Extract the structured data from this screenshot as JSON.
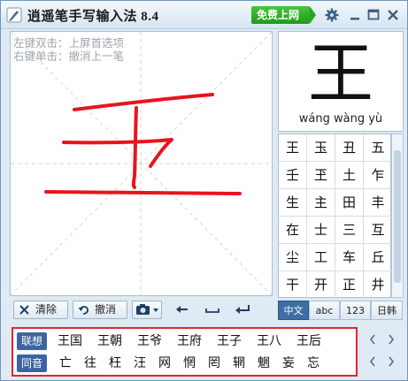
{
  "titlebar": {
    "title": "逍遥笔手写输入法 8.4",
    "free_button": "免费上网"
  },
  "canvas": {
    "hint_line1": "左键双击：上屏首选项",
    "hint_line2": "右键单击：撤消上一笔"
  },
  "toolbar": {
    "clear_label": "清除",
    "undo_label": "撤消"
  },
  "preview": {
    "char": "王",
    "pinyin": "wáng wàng yù"
  },
  "candidate_grid": [
    "王",
    "玉",
    "丑",
    "五",
    "壬",
    "玊",
    "土",
    "乍",
    "生",
    "主",
    "田",
    "丰",
    "在",
    "士",
    "三",
    "互",
    "尘",
    "工",
    "车",
    "丘",
    "干",
    "开",
    "正",
    "井"
  ],
  "modes": [
    "中文",
    "abc",
    "123",
    "日韩"
  ],
  "associations": {
    "label": "联想",
    "words": [
      "王国",
      "王朝",
      "王爷",
      "王府",
      "王子",
      "王八",
      "王后"
    ]
  },
  "homophones": {
    "label": "同音",
    "chars": [
      "亡",
      "往",
      "枉",
      "汪",
      "网",
      "惘",
      "罔",
      "辋",
      "魍",
      "妄",
      "忘"
    ]
  },
  "colors": {
    "accent": "#3e6ea3",
    "stroke": "#e8141c",
    "highlight_border": "#e0282a",
    "free_button": "#2aa423"
  }
}
